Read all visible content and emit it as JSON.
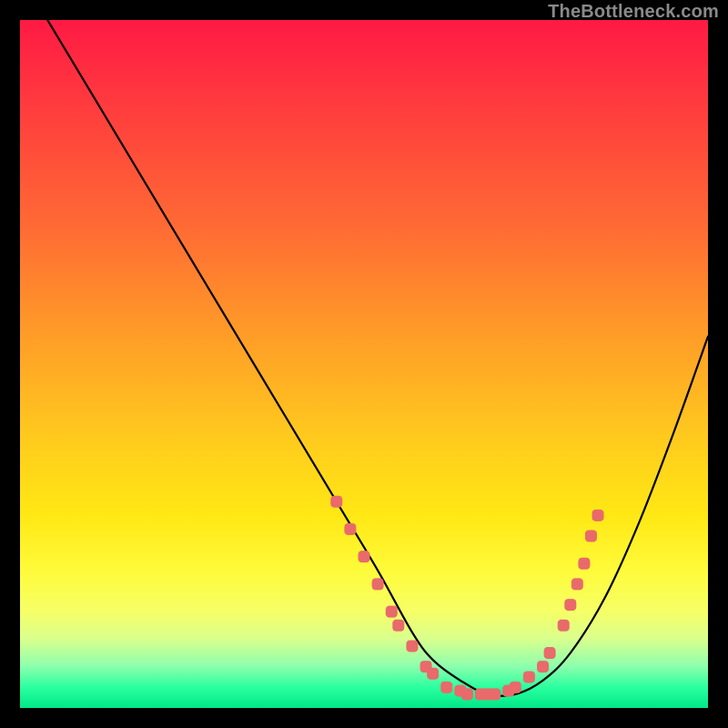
{
  "watermark": "TheBottleneck.com",
  "colors": {
    "page_bg": "#000000",
    "curve_stroke": "#000000",
    "dot_fill": "#e96a6a",
    "gradient_top": "#ff1a44",
    "gradient_bottom": "#00e887"
  },
  "chart_data": {
    "type": "line",
    "title": "",
    "xlabel": "",
    "ylabel": "",
    "xlim": [
      0,
      100
    ],
    "ylim": [
      0,
      100
    ],
    "series": [
      {
        "name": "curve",
        "x": [
          4,
          10,
          16,
          22,
          28,
          34,
          40,
          46,
          52,
          57,
          60,
          64,
          68,
          72,
          76,
          80,
          85,
          90,
          95,
          100
        ],
        "y": [
          100,
          90,
          80,
          70,
          60,
          50,
          40,
          30,
          20,
          11,
          7,
          4,
          2,
          2,
          4,
          8,
          16,
          27,
          40,
          54
        ]
      }
    ],
    "dots": [
      {
        "x": 46,
        "y": 30
      },
      {
        "x": 48,
        "y": 26
      },
      {
        "x": 50,
        "y": 22
      },
      {
        "x": 52,
        "y": 18
      },
      {
        "x": 54,
        "y": 14
      },
      {
        "x": 55,
        "y": 12
      },
      {
        "x": 57,
        "y": 9
      },
      {
        "x": 59,
        "y": 6
      },
      {
        "x": 60,
        "y": 5
      },
      {
        "x": 62,
        "y": 3
      },
      {
        "x": 64,
        "y": 2.5
      },
      {
        "x": 65,
        "y": 2
      },
      {
        "x": 67,
        "y": 2
      },
      {
        "x": 68,
        "y": 2
      },
      {
        "x": 69,
        "y": 2
      },
      {
        "x": 71,
        "y": 2.5
      },
      {
        "x": 72,
        "y": 3
      },
      {
        "x": 74,
        "y": 4.5
      },
      {
        "x": 76,
        "y": 6
      },
      {
        "x": 77,
        "y": 8
      },
      {
        "x": 79,
        "y": 12
      },
      {
        "x": 80,
        "y": 15
      },
      {
        "x": 81,
        "y": 18
      },
      {
        "x": 82,
        "y": 21
      },
      {
        "x": 83,
        "y": 25
      },
      {
        "x": 84,
        "y": 28
      }
    ]
  }
}
